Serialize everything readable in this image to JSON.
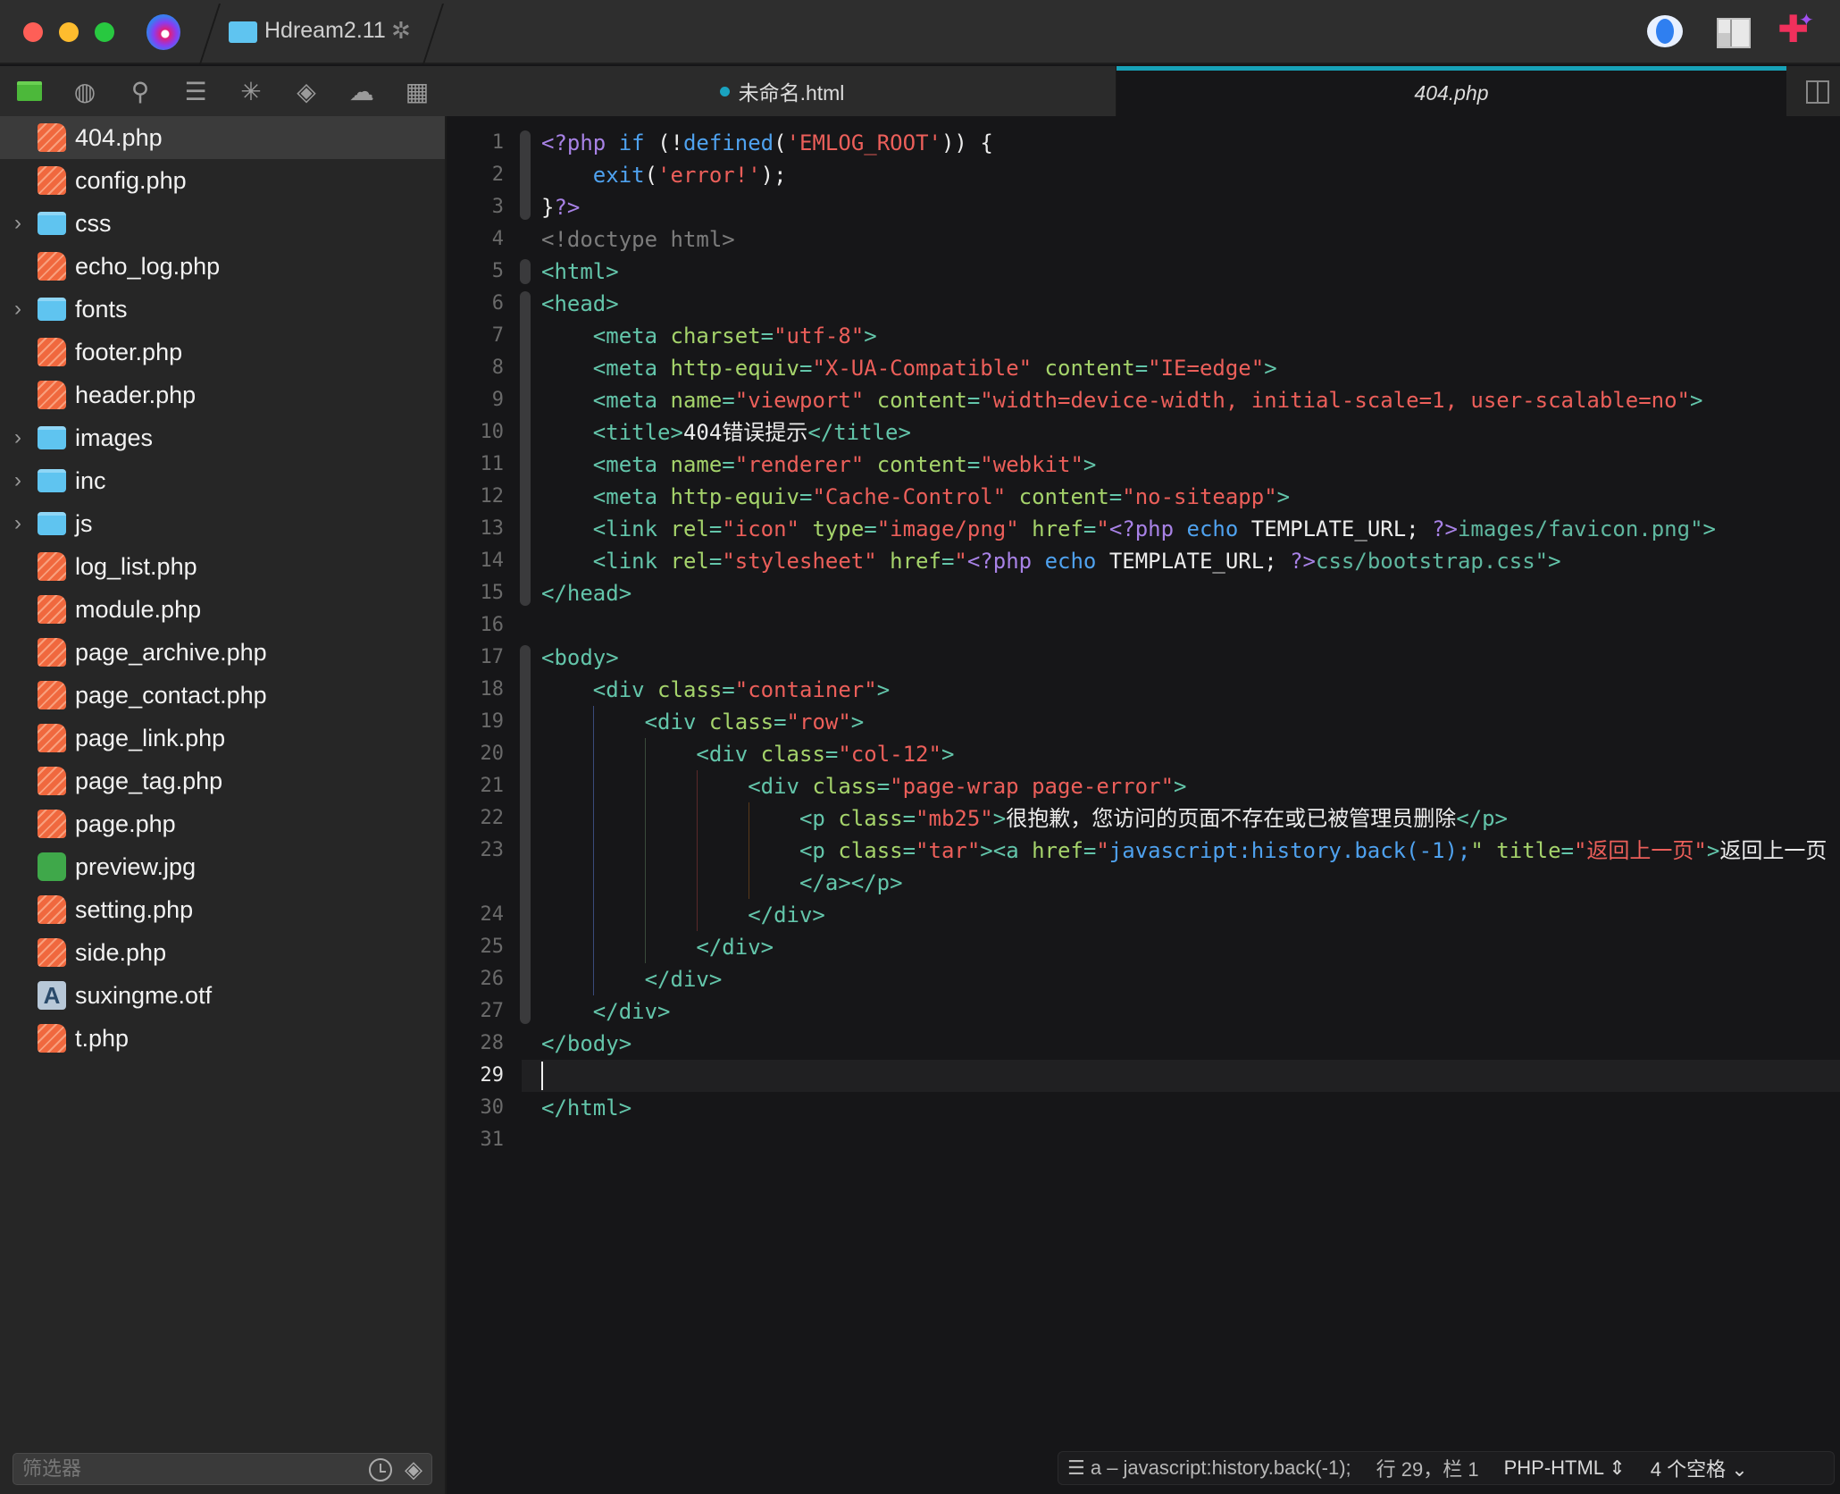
{
  "window": {
    "project_name": "Hdream2.11"
  },
  "colors": {
    "accent": "#17a2b8",
    "tag": "#63c5aa",
    "attribute": "#a5d36b",
    "string": "#ec5f5a",
    "php_keyword": "#a882e6",
    "function": "#4fa2ef"
  },
  "toolbar": {
    "icons": [
      "folder-icon",
      "globe-icon",
      "search-icon",
      "outline-icon",
      "asterisk-icon",
      "git-icon",
      "cloud-upload-icon",
      "grid-icon"
    ]
  },
  "sidebar": {
    "items": [
      {
        "label": "404.php",
        "type": "php",
        "selected": true
      },
      {
        "label": "config.php",
        "type": "php"
      },
      {
        "label": "css",
        "type": "folder"
      },
      {
        "label": "echo_log.php",
        "type": "php"
      },
      {
        "label": "fonts",
        "type": "folder"
      },
      {
        "label": "footer.php",
        "type": "php"
      },
      {
        "label": "header.php",
        "type": "php"
      },
      {
        "label": "images",
        "type": "folder"
      },
      {
        "label": "inc",
        "type": "folder"
      },
      {
        "label": "js",
        "type": "folder"
      },
      {
        "label": "log_list.php",
        "type": "php"
      },
      {
        "label": "module.php",
        "type": "php"
      },
      {
        "label": "page_archive.php",
        "type": "php"
      },
      {
        "label": "page_contact.php",
        "type": "php"
      },
      {
        "label": "page_link.php",
        "type": "php"
      },
      {
        "label": "page_tag.php",
        "type": "php"
      },
      {
        "label": "page.php",
        "type": "php"
      },
      {
        "label": "preview.jpg",
        "type": "image"
      },
      {
        "label": "setting.php",
        "type": "php"
      },
      {
        "label": "side.php",
        "type": "php"
      },
      {
        "label": "suxingme.otf",
        "type": "font"
      },
      {
        "label": "t.php",
        "type": "php"
      }
    ],
    "filter_placeholder": "筛选器"
  },
  "tabs": [
    {
      "label": "未命名.html",
      "modified": true,
      "active": false
    },
    {
      "label": "404.php",
      "active": true
    }
  ],
  "editor": {
    "current_line": 29,
    "lines": [
      {
        "n": "1",
        "tokens": [
          [
            "k",
            "<?php "
          ],
          [
            "f",
            "if "
          ],
          [
            "p",
            "(!"
          ],
          [
            "f",
            "defined"
          ],
          [
            "p",
            "("
          ],
          [
            "s",
            "'EMLOG_ROOT'"
          ],
          [
            "p",
            ")) {"
          ]
        ]
      },
      {
        "n": "2",
        "tokens": [
          [
            "p",
            "    "
          ],
          [
            "f",
            "exit"
          ],
          [
            "p",
            "("
          ],
          [
            "s",
            "'error!'"
          ],
          [
            "p",
            ");"
          ]
        ]
      },
      {
        "n": "3",
        "tokens": [
          [
            "p",
            "}"
          ],
          [
            "k",
            "?>"
          ]
        ]
      },
      {
        "n": "4",
        "tokens": [
          [
            "c",
            "<!doctype html>"
          ]
        ]
      },
      {
        "n": "5",
        "tokens": [
          [
            "t",
            "<html>"
          ]
        ]
      },
      {
        "n": "6",
        "tokens": [
          [
            "t",
            "<head>"
          ]
        ]
      },
      {
        "n": "7",
        "tokens": [
          [
            "p",
            "    "
          ],
          [
            "t",
            "<meta "
          ],
          [
            "a",
            "charset"
          ],
          [
            "t",
            "="
          ],
          [
            "s",
            "\"utf-8\""
          ],
          [
            "t",
            ">"
          ]
        ]
      },
      {
        "n": "8",
        "tokens": [
          [
            "p",
            "    "
          ],
          [
            "t",
            "<meta "
          ],
          [
            "a",
            "http-equiv"
          ],
          [
            "t",
            "="
          ],
          [
            "s",
            "\"X-UA-Compatible\""
          ],
          [
            "a",
            " content"
          ],
          [
            "t",
            "="
          ],
          [
            "s",
            "\"IE=edge\""
          ],
          [
            "t",
            ">"
          ]
        ]
      },
      {
        "n": "9",
        "tokens": [
          [
            "p",
            "    "
          ],
          [
            "t",
            "<meta "
          ],
          [
            "a",
            "name"
          ],
          [
            "t",
            "="
          ],
          [
            "s",
            "\"viewport\""
          ],
          [
            "a",
            " content"
          ],
          [
            "t",
            "="
          ],
          [
            "s",
            "\"width=device-width, initial-scale=1, user-scalable=no\""
          ],
          [
            "t",
            ">"
          ]
        ]
      },
      {
        "n": "10",
        "tokens": [
          [
            "p",
            "    "
          ],
          [
            "t",
            "<title>"
          ],
          [
            "p",
            "404错误提示"
          ],
          [
            "t",
            "</title>"
          ]
        ]
      },
      {
        "n": "11",
        "tokens": [
          [
            "p",
            "    "
          ],
          [
            "t",
            "<meta "
          ],
          [
            "a",
            "name"
          ],
          [
            "t",
            "="
          ],
          [
            "s",
            "\"renderer\""
          ],
          [
            "a",
            " content"
          ],
          [
            "t",
            "="
          ],
          [
            "s",
            "\"webkit\""
          ],
          [
            "t",
            ">"
          ]
        ]
      },
      {
        "n": "12",
        "tokens": [
          [
            "p",
            "    "
          ],
          [
            "t",
            "<meta "
          ],
          [
            "a",
            "http-equiv"
          ],
          [
            "t",
            "="
          ],
          [
            "s",
            "\"Cache-Control\""
          ],
          [
            "a",
            " content"
          ],
          [
            "t",
            "="
          ],
          [
            "s",
            "\"no-siteapp\""
          ],
          [
            "t",
            ">"
          ]
        ]
      },
      {
        "n": "13",
        "tokens": [
          [
            "p",
            "    "
          ],
          [
            "t",
            "<link "
          ],
          [
            "a",
            "rel"
          ],
          [
            "t",
            "="
          ],
          [
            "s",
            "\"icon\""
          ],
          [
            "a",
            " type"
          ],
          [
            "t",
            "="
          ],
          [
            "s",
            "\"image/png\""
          ],
          [
            "a",
            " href"
          ],
          [
            "t",
            "="
          ],
          [
            "s",
            "\""
          ],
          [
            "k",
            "<?php "
          ],
          [
            "f",
            "echo "
          ],
          [
            "p",
            "TEMPLATE_URL; "
          ],
          [
            "k",
            "?>"
          ],
          [
            "ts",
            "images/favicon.png\""
          ],
          [
            "t",
            ">"
          ]
        ]
      },
      {
        "n": "14",
        "tokens": [
          [
            "p",
            "    "
          ],
          [
            "t",
            "<link "
          ],
          [
            "a",
            "rel"
          ],
          [
            "t",
            "="
          ],
          [
            "s",
            "\"stylesheet\""
          ],
          [
            "a",
            " href"
          ],
          [
            "t",
            "="
          ],
          [
            "s",
            "\""
          ],
          [
            "k",
            "<?php "
          ],
          [
            "f",
            "echo "
          ],
          [
            "p",
            "TEMPLATE_URL; "
          ],
          [
            "k",
            "?>"
          ],
          [
            "ts",
            "css/bootstrap.css\""
          ],
          [
            "t",
            ">"
          ]
        ]
      },
      {
        "n": "15",
        "tokens": [
          [
            "t",
            "</head>"
          ]
        ]
      },
      {
        "n": "16",
        "tokens": []
      },
      {
        "n": "17",
        "tokens": [
          [
            "t",
            "<body>"
          ]
        ]
      },
      {
        "n": "18",
        "tokens": [
          [
            "p",
            "    "
          ],
          [
            "t",
            "<div "
          ],
          [
            "a",
            "class"
          ],
          [
            "t",
            "="
          ],
          [
            "s",
            "\"container\""
          ],
          [
            "t",
            ">"
          ]
        ]
      },
      {
        "n": "19",
        "tokens": [
          [
            "p",
            "        "
          ],
          [
            "t",
            "<div "
          ],
          [
            "a",
            "class"
          ],
          [
            "t",
            "="
          ],
          [
            "s",
            "\"row\""
          ],
          [
            "t",
            ">"
          ]
        ]
      },
      {
        "n": "20",
        "tokens": [
          [
            "p",
            "            "
          ],
          [
            "t",
            "<div "
          ],
          [
            "a",
            "class"
          ],
          [
            "t",
            "="
          ],
          [
            "s",
            "\"col-12\""
          ],
          [
            "t",
            ">"
          ]
        ]
      },
      {
        "n": "21",
        "tokens": [
          [
            "p",
            "                "
          ],
          [
            "t",
            "<div "
          ],
          [
            "a",
            "class"
          ],
          [
            "t",
            "="
          ],
          [
            "s",
            "\"page-wrap page-error\""
          ],
          [
            "t",
            ">"
          ]
        ]
      },
      {
        "n": "22",
        "tokens": [
          [
            "p",
            "                    "
          ],
          [
            "t",
            "<p "
          ],
          [
            "a",
            "class"
          ],
          [
            "t",
            "="
          ],
          [
            "s",
            "\"mb25\""
          ],
          [
            "t",
            ">"
          ],
          [
            "p",
            "很抱歉，您访问的页面不存在或已被管理员删除"
          ],
          [
            "t",
            "</p>"
          ]
        ]
      },
      {
        "n": "23",
        "tokens": [
          [
            "p",
            "                    "
          ],
          [
            "t",
            "<p "
          ],
          [
            "a",
            "class"
          ],
          [
            "t",
            "="
          ],
          [
            "s",
            "\"tar\""
          ],
          [
            "t",
            "><a "
          ],
          [
            "a",
            "href"
          ],
          [
            "t",
            "="
          ],
          [
            "s",
            "\""
          ],
          [
            "f",
            "javascript:history.back(-1);"
          ],
          [
            "a",
            "\" title"
          ],
          [
            "t",
            "="
          ],
          [
            "s",
            "\"返回上一页\""
          ],
          [
            "t",
            ">"
          ],
          [
            "p",
            "返回上一页"
          ]
        ]
      },
      {
        "n": "",
        "tokens": [
          [
            "p",
            "                    "
          ],
          [
            "t",
            "</a></p>"
          ]
        ]
      },
      {
        "n": "24",
        "tokens": [
          [
            "p",
            "                "
          ],
          [
            "t",
            "</div>"
          ]
        ]
      },
      {
        "n": "25",
        "tokens": [
          [
            "p",
            "            "
          ],
          [
            "t",
            "</div>"
          ]
        ]
      },
      {
        "n": "26",
        "tokens": [
          [
            "p",
            "        "
          ],
          [
            "t",
            "</div>"
          ]
        ]
      },
      {
        "n": "27",
        "tokens": [
          [
            "p",
            "    "
          ],
          [
            "t",
            "</div>"
          ]
        ]
      },
      {
        "n": "28",
        "tokens": [
          [
            "t",
            "</body>"
          ]
        ]
      },
      {
        "n": "29",
        "tokens": []
      },
      {
        "n": "30",
        "tokens": [
          [
            "t",
            "</html>"
          ]
        ]
      },
      {
        "n": "31",
        "tokens": []
      }
    ]
  },
  "statusbar": {
    "symbol": "a – javascript:history.back(-1);",
    "position": "行 29，栏 1",
    "language": "PHP-HTML",
    "indentation": "4 个空格"
  }
}
